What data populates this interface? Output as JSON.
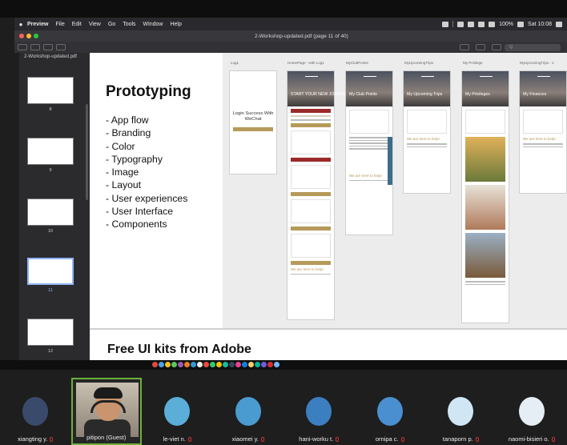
{
  "menubar": {
    "app": "Preview",
    "items": [
      "File",
      "Edit",
      "View",
      "Go",
      "Tools",
      "Window",
      "Help"
    ],
    "battery": "100%",
    "clock": "Sat 10:08"
  },
  "window": {
    "title": "2-Workshop-updated.pdf (page 11 of 40)",
    "search_placeholder": "Q"
  },
  "sidebar": {
    "filename": "2-Workshop-updated.pdf",
    "pages": [
      "8",
      "9",
      "10",
      "11",
      "12"
    ],
    "selected_page": "11"
  },
  "slide": {
    "title": "Prototyping",
    "bullets": [
      "App flow",
      "Branding",
      "Color",
      "Typography",
      "Image",
      "Layout",
      "User experiences",
      "User Interface",
      "Components"
    ],
    "next_title": "Free UI kits from Adobe"
  },
  "screens": {
    "login_label": "Log1",
    "login_text": "Login Success With WeChat",
    "home_label": "HomePage - with Log1",
    "home_hero": "START YOUR NEW JOURNEY",
    "club_label": "MyClubPoints",
    "club_hero": "My Club Points",
    "upcoming_label": "MyUpcomingTrips",
    "upcoming_hero": "My Upcoming Trips",
    "help_text": "We are here to help!",
    "prot_label": "My Privilege",
    "prot_hero": "My Privileges",
    "fin_label": "MyUpcomingTrips - 1",
    "fin_hero": "My Finances"
  },
  "participants": [
    {
      "name": "xiangting y.",
      "color": "#3a4a6a"
    },
    {
      "name": "pitipon (Guest)",
      "color": "#c9946e"
    },
    {
      "name": "le-viet n.",
      "color": "#5aaed8"
    },
    {
      "name": "xiaomei y.",
      "color": "#4a9bd0"
    },
    {
      "name": "hani-worku t.",
      "color": "#3b7fc0"
    },
    {
      "name": "ornipa c.",
      "color": "#4a8fd0"
    },
    {
      "name": "tanaporn p.",
      "color": "#d0e6f5"
    },
    {
      "name": "naomi-bisieri o.",
      "color": "#e6eef5"
    }
  ],
  "colors": {
    "accent": "#6fb03b",
    "gold": "#b59a5a",
    "muted_red": "#c33"
  }
}
